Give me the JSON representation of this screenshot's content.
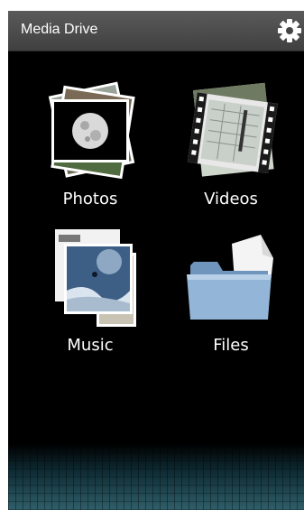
{
  "app": {
    "title": "Media Drive"
  },
  "header": {
    "settings_icon": "gear-icon"
  },
  "tiles": [
    {
      "label": "Photos",
      "icon": "photos-stack-icon"
    },
    {
      "label": "Videos",
      "icon": "videos-stack-icon"
    },
    {
      "label": "Music",
      "icon": "music-stack-icon"
    },
    {
      "label": "Files",
      "icon": "folder-icon"
    }
  ],
  "colors": {
    "background": "#000000",
    "titlebar": "#4a4a4a",
    "folder": "#8fb3d6"
  }
}
